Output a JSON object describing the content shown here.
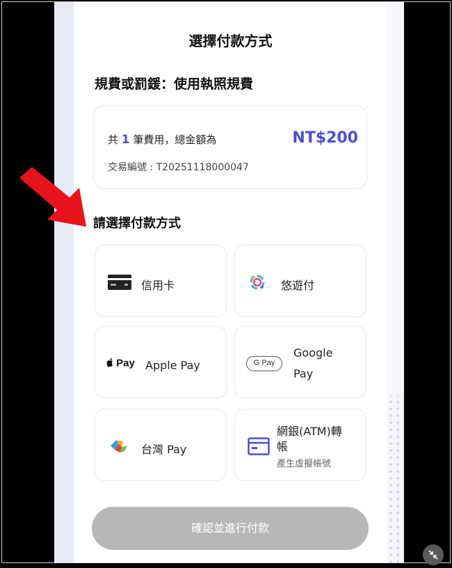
{
  "header": {
    "title": "選擇付款方式"
  },
  "fee": {
    "category": "規費或罰鍰：使用執照規費"
  },
  "summary": {
    "prefix": "共",
    "count": "1",
    "suffix": "筆費用，總金額為",
    "total": "NT$200",
    "transaction_label": "交易編號 : T20251118000047"
  },
  "payment": {
    "section_label": "請選擇付款方式",
    "options": [
      {
        "label": "信用卡",
        "icon": "credit-card-icon"
      },
      {
        "label": "悠遊付",
        "icon": "easywallet-logo-icon"
      },
      {
        "label": "Apple Pay",
        "icon": "apple-pay-logo-icon",
        "logo_text": "Pay"
      },
      {
        "label_line1": "Google",
        "label_line2": "Pay",
        "icon": "google-pay-logo-icon",
        "logo_text": "G Pay"
      },
      {
        "label": "台灣 Pay",
        "icon": "taiwan-pay-logo-icon"
      },
      {
        "label": "網銀(ATM)轉帳",
        "label_line1": "網銀(ATM)轉",
        "label_line2": "帳",
        "sublabel": "產生虛擬帳號",
        "icon": "bank-transfer-icon"
      }
    ]
  },
  "confirm_button": {
    "label": "確認並進行付款"
  },
  "colors": {
    "accent": "#4a4fd6",
    "disabled_button": "#b7b7b7",
    "arrow": "#e8141b"
  }
}
